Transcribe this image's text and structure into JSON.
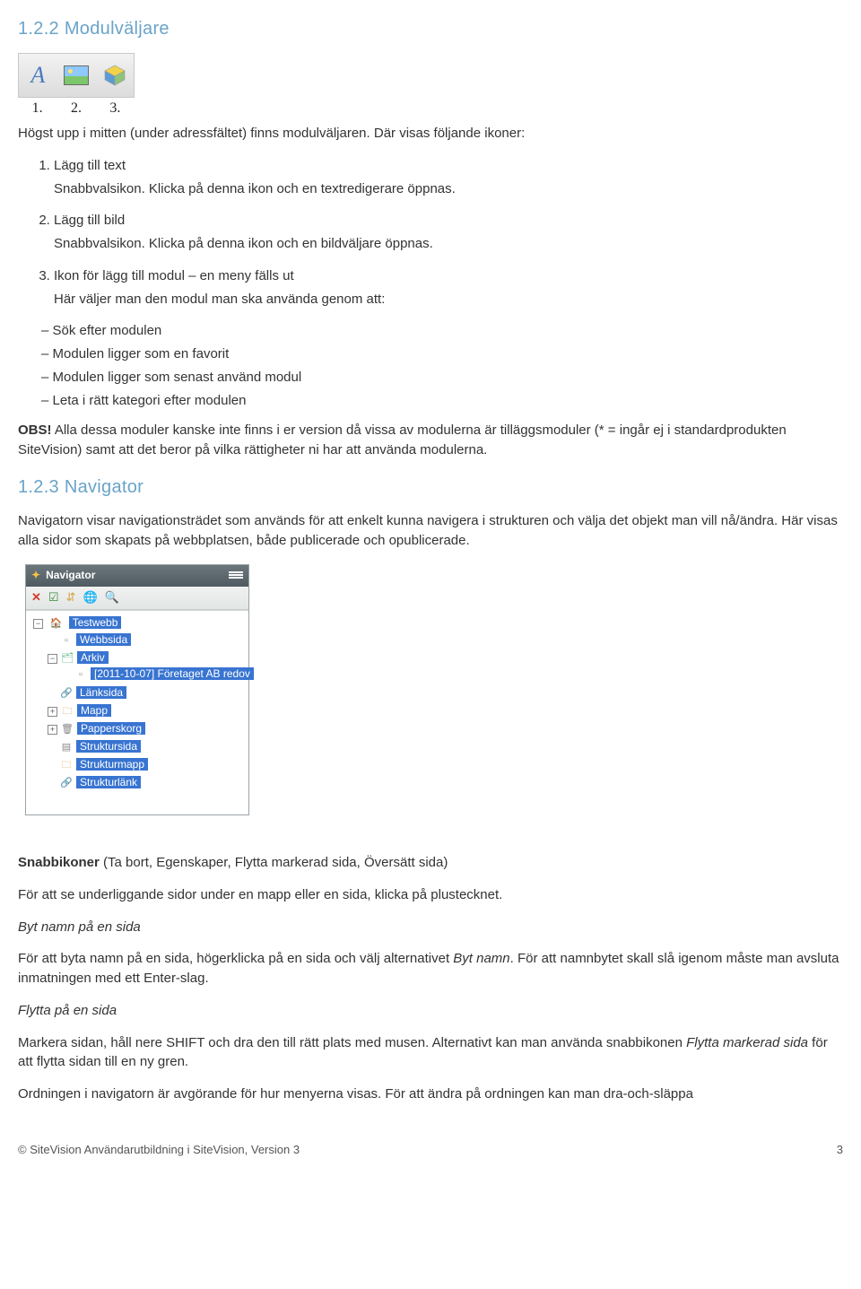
{
  "sections": {
    "modulvaljare_heading": "1.2.2 Modulväljare",
    "navigator_heading": "1.2.3 Navigator"
  },
  "toolbar_figure": {
    "labels": [
      "1.",
      "2.",
      "3."
    ]
  },
  "modulvaljare_intro": "Högst upp i mitten (under adressfältet) finns modulväljaren. Där visas följande ikoner:",
  "steps": [
    {
      "title": "Lägg till text",
      "desc": "Snabbvalsikon. Klicka på denna ikon och en textredigerare öppnas."
    },
    {
      "title": "Lägg till bild",
      "desc": "Snabbvalsikon. Klicka på denna ikon och en bildväljare öppnas."
    },
    {
      "title": "Ikon för lägg till modul – en meny fälls ut",
      "desc": "Här väljer man den modul man ska använda genom att:"
    }
  ],
  "module_bullets": [
    "Sök efter modulen",
    "Modulen ligger som en favorit",
    "Modulen ligger som senast använd modul",
    "Leta i rätt kategori efter modulen"
  ],
  "obs_label": "OBS!",
  "obs_text": " Alla dessa moduler kanske inte finns i er version då vissa av modulerna är tilläggsmoduler (* = ingår ej i standardprodukten SiteVision) samt att det beror på vilka rättigheter ni har att använda modulerna.",
  "navigator_intro": "Navigatorn visar navigationsträdet som används för att enkelt kunna navigera i strukturen och välja det objekt man vill nå/ändra. Här visas alla sidor som skapats på webbplatsen, både publicerade och opublicerade.",
  "navigator_panel": {
    "title": "Navigator",
    "tree": {
      "root": "Testwebb",
      "children": [
        {
          "icon": "page",
          "toggle": "",
          "label": "Webbsida"
        },
        {
          "icon": "arch",
          "toggle": "-",
          "label": "Arkiv",
          "children": [
            {
              "icon": "page",
              "toggle": "",
              "label": "[2011-10-07] Företaget AB redov"
            }
          ]
        },
        {
          "icon": "link",
          "toggle": "",
          "label": "Länksida"
        },
        {
          "icon": "folder",
          "toggle": "+",
          "label": "Mapp"
        },
        {
          "icon": "trash",
          "toggle": "+",
          "label": "Papperskorg"
        },
        {
          "icon": "struct",
          "toggle": "",
          "label": "Struktursida"
        },
        {
          "icon": "folder",
          "toggle": "",
          "label": "Strukturmapp"
        },
        {
          "icon": "link",
          "toggle": "",
          "label": "Strukturlänk"
        }
      ]
    }
  },
  "snabbikoner_label": "Snabbikoner",
  "snabbikoner_paren": " (Ta bort, Egenskaper, Flytta markerad sida, Översätt sida)",
  "plusteckn": "För att se underliggande sidor under en mapp eller en sida, klicka på plustecknet.",
  "bytnamn_heading": " Byt namn på en sida",
  "bytnamn_text_1": "För att byta namn på en sida, högerklicka på en sida och välj alternativet ",
  "bytnamn_italic": "Byt namn",
  "bytnamn_text_2": ". För att namnbytet skall slå igenom måste man avsluta inmatningen med ett Enter-slag.",
  "flytta_heading": " Flytta på en sida",
  "flytta_text_1": "Markera sidan, håll nere SHIFT och dra den till rätt plats med musen. Alternativt kan man använda snabbikonen ",
  "flytta_italic": "Flytta markerad sida",
  "flytta_text_2": " för att flytta sidan till en ny gren.",
  "ordning": "Ordningen i navigatorn är avgörande för hur menyerna visas. För att ändra på ordningen kan man dra-och-släppa",
  "footer": {
    "left": "© SiteVision Användarutbildning i SiteVision, Version 3",
    "right": "3"
  }
}
